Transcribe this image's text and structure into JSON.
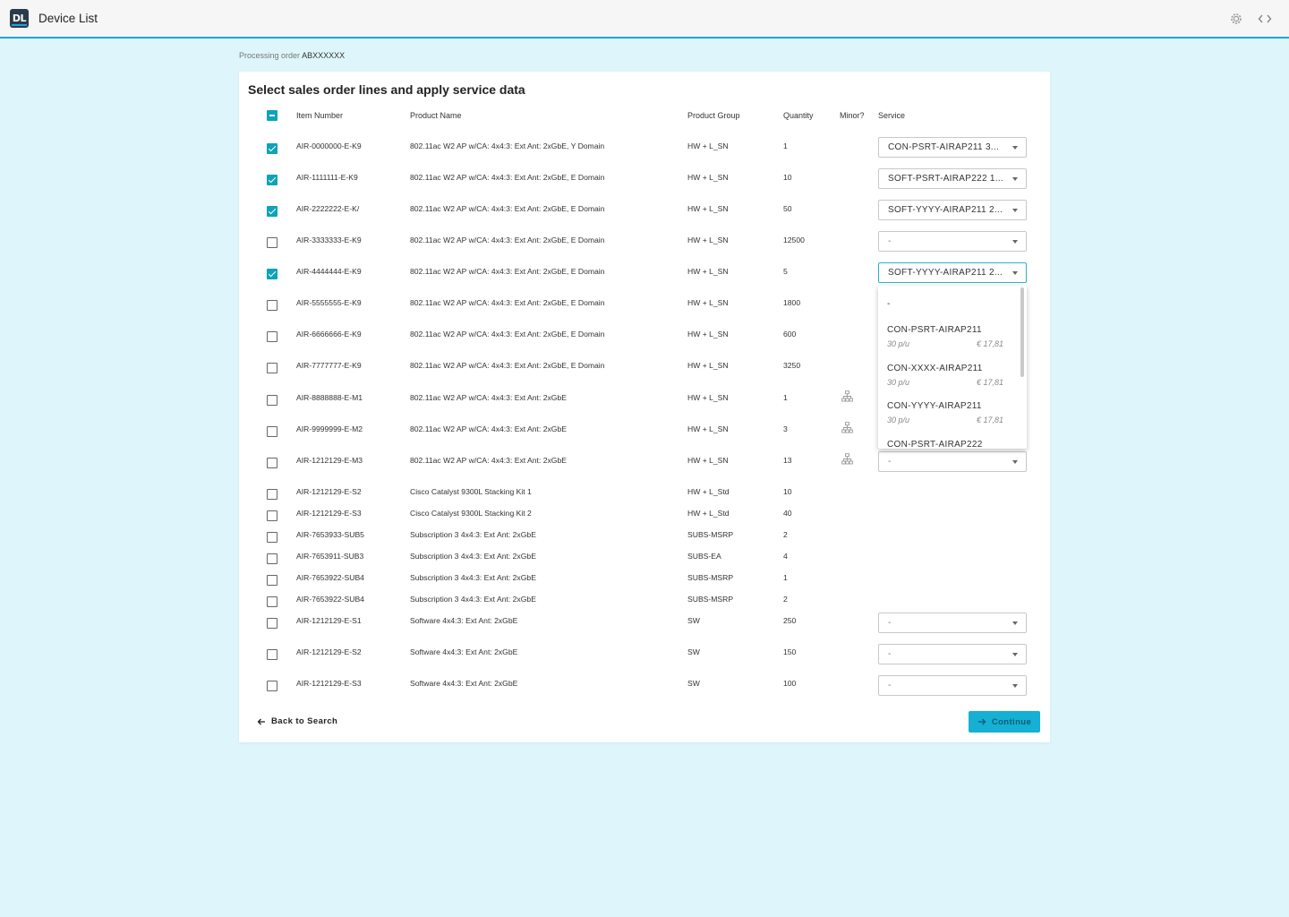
{
  "app": {
    "logo_text": "DL",
    "title": "Device List"
  },
  "breadcrumb": {
    "prefix": "Processing order",
    "order_id": "ABXXXXXX"
  },
  "card": {
    "title": "Select sales order lines and apply service data"
  },
  "columns": {
    "item_number": "Item Number",
    "product_name": "Product Name",
    "product_group": "Product Group",
    "quantity": "Quantity",
    "minor": "Minor?",
    "service": "Service"
  },
  "rows": [
    {
      "item": "AIR-0000000-E-K9",
      "name": "802.11ac W2 AP w/CA: 4x4:3: Ext Ant: 2xGbE, Y Domain",
      "group": "HW + L_SN",
      "qty": "1",
      "checked": true,
      "service": "CON-PSRT-AIRAP211   3..."
    },
    {
      "item": "AIR-1111111-E-K9",
      "name": "802.11ac W2 AP w/CA: 4x4:3: Ext Ant: 2xGbE, E Domain",
      "group": "HW + L_SN",
      "qty": "10",
      "checked": true,
      "service": "SOFT-PSRT-AIRAP222   1..."
    },
    {
      "item": "AIR-2222222-E-K/",
      "name": "802.11ac W2 AP w/CA: 4x4:3: Ext Ant: 2xGbE, E Domain",
      "group": "HW + L_SN",
      "qty": "50",
      "checked": true,
      "service": "SOFT-YYYY-AIRAP211   2..."
    },
    {
      "item": "AIR-3333333-E-K9",
      "name": "802.11ac W2 AP w/CA: 4x4:3: Ext Ant: 2xGbE, E Domain",
      "group": "HW + L_SN",
      "qty": "12500",
      "checked": false,
      "service": "-"
    },
    {
      "item": "AIR-4444444-E-K9",
      "name": "802.11ac W2 AP w/CA: 4x4:3: Ext Ant: 2xGbE, E Domain",
      "group": "HW + L_SN",
      "qty": "5",
      "checked": true,
      "service": "SOFT-YYYY-AIRAP211   2..."
    },
    {
      "item": "AIR-5555555-E-K9",
      "name": "802.11ac W2 AP w/CA: 4x4:3: Ext Ant: 2xGbE, E Domain",
      "group": "HW + L_SN",
      "qty": "1800",
      "checked": false
    },
    {
      "item": "AIR-6666666-E-K9",
      "name": "802.11ac W2 AP w/CA: 4x4:3: Ext Ant: 2xGbE, E Domain",
      "group": "HW + L_SN",
      "qty": "600",
      "checked": false
    },
    {
      "item": "AIR-7777777-E-K9",
      "name": "802.11ac W2 AP w/CA: 4x4:3: Ext Ant: 2xGbE, E Domain",
      "group": "HW + L_SN",
      "qty": "3250",
      "checked": false
    },
    {
      "item": "AIR-8888888-E-M1",
      "name": "802.11ac W2 AP w/CA: 4x4:3: Ext Ant: 2xGbE",
      "group": "HW + L_SN",
      "qty": "1",
      "checked": false
    },
    {
      "item": "AIR-9999999-E-M2",
      "name": "802.11ac W2 AP w/CA: 4x4:3: Ext Ant: 2xGbE",
      "group": "HW + L_SN",
      "qty": "3",
      "checked": false
    },
    {
      "item": "AIR-1212129-E-M3",
      "name": "802.11ac W2 AP w/CA: 4x4:3: Ext Ant: 2xGbE",
      "group": "HW + L_SN",
      "qty": "13",
      "checked": false,
      "service": "-"
    },
    {
      "item": "AIR-1212129-E-S2",
      "name": "Cisco Catalyst 9300L Stacking Kit 1",
      "group": "HW + L_Std",
      "qty": "10",
      "checked": false
    },
    {
      "item": "AIR-1212129-E-S3",
      "name": "Cisco Catalyst 9300L Stacking Kit 2",
      "group": "HW + L_Std",
      "qty": "40",
      "checked": false
    },
    {
      "item": "AIR-7653933-SUB5",
      "name": "Subscription 3 4x4:3: Ext Ant: 2xGbE",
      "group": "SUBS-MSRP",
      "qty": "2",
      "checked": false
    },
    {
      "item": "AIR-7653911-SUB3",
      "name": "Subscription 3 4x4:3: Ext Ant: 2xGbE",
      "group": "SUBS-EA",
      "qty": "4",
      "checked": false
    },
    {
      "item": "AIR-7653922-SUB4",
      "name": "Subscription 3 4x4:3: Ext Ant: 2xGbE",
      "group": "SUBS-MSRP",
      "qty": "1",
      "checked": false
    },
    {
      "item": "AIR-7653922-SUB4",
      "name": "Subscription 3 4x4:3: Ext Ant: 2xGbE",
      "group": "SUBS-MSRP",
      "qty": "2",
      "checked": false
    },
    {
      "item": "AIR-1212129-E-S1",
      "name": "Software 4x4:3: Ext Ant: 2xGbE",
      "group": "SW",
      "qty": "250",
      "checked": false,
      "service": "-"
    },
    {
      "item": "AIR-1212129-E-S2",
      "name": "Software 4x4:3: Ext Ant: 2xGbE",
      "group": "SW",
      "qty": "150",
      "checked": false,
      "service": "-"
    },
    {
      "item": "AIR-1212129-E-S3",
      "name": "Software 4x4:3: Ext Ant: 2xGbE",
      "group": "SW",
      "qty": "100",
      "checked": false,
      "service": "-"
    }
  ],
  "dropdown": {
    "options": [
      {
        "label": "-"
      },
      {
        "label": "CON-PSRT-AIRAP211",
        "unit": "30 p/u",
        "price": "€ 17,81"
      },
      {
        "label": "CON-XXXX-AIRAP211",
        "unit": "30 p/u",
        "price": "€ 17,81"
      },
      {
        "label": "CON-YYYY-AIRAP211",
        "unit": "30 p/u",
        "price": "€ 17,81"
      },
      {
        "label": "CON-PSRT-AIRAP222"
      }
    ]
  },
  "actions": {
    "back_label": "Back to Search",
    "continue_label": "Continue"
  },
  "colors": {
    "accent": "#0fa3b7",
    "button": "#15b0d3",
    "background": "#def6fb"
  }
}
